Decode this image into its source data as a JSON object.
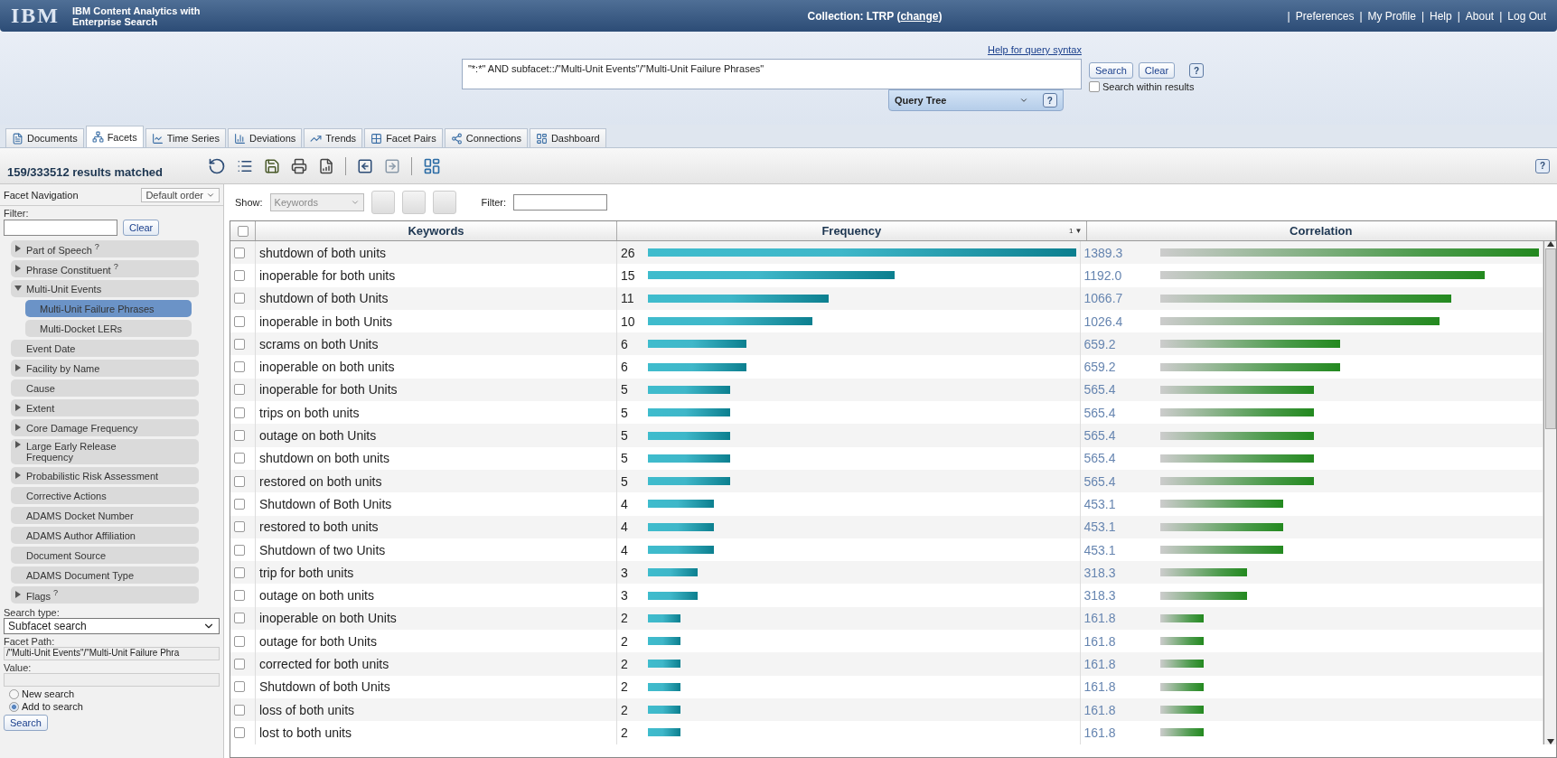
{
  "header": {
    "logo": "IBM",
    "product": [
      "IBM Content Analytics with",
      "Enterprise Search"
    ],
    "collection_label": "Collection: LTRP",
    "collection_open": "(",
    "change_link": "change",
    "collection_close": ")",
    "separator": "|",
    "links": [
      "Preferences",
      "My Profile",
      "Help",
      "About",
      "Log Out"
    ]
  },
  "query": {
    "help_link": "Help for query syntax",
    "value": "\"*:*\" AND subfacet::/\"Multi-Unit Events\"/\"Multi-Unit Failure Phrases\"",
    "search_button": "Search",
    "clear_button": "Clear",
    "help_button": "?",
    "within_results": {
      "label": "Search within results",
      "checked": false
    },
    "query_tree": {
      "title": "Query Tree",
      "help_button": "?"
    }
  },
  "tabs": [
    {
      "label": "Documents",
      "selected": false,
      "kind": "documents"
    },
    {
      "label": "Facets",
      "selected": true,
      "kind": "facets"
    },
    {
      "label": "Time Series",
      "selected": false,
      "kind": "timeseries"
    },
    {
      "label": "Deviations",
      "selected": false,
      "kind": "deviations"
    },
    {
      "label": "Trends",
      "selected": false,
      "kind": "trends"
    },
    {
      "label": "Facet Pairs",
      "selected": false,
      "kind": "pairs"
    },
    {
      "label": "Connections",
      "selected": false,
      "kind": "connections"
    },
    {
      "label": "Dashboard",
      "selected": false,
      "kind": "dashboard"
    }
  ],
  "toolbar": {
    "results": "159/333512 results matched",
    "help_button": "?"
  },
  "facet_nav": {
    "title": "Facet Navigation",
    "order": "Default order",
    "filter_label": "Filter:",
    "clear_button": "Clear",
    "items": [
      {
        "label": "Part of Speech $^{?}$",
        "expanded": false
      },
      {
        "label": "Phrase Constituent $^{?}$",
        "expanded": false
      },
      {
        "label": "Multi-Unit Events",
        "expanded": true,
        "children": [
          {
            "label": "Multi-Unit Failure Phrases",
            "selected": true
          },
          {
            "label": "Multi-Docket LERs",
            "selected": false
          }
        ]
      },
      {
        "label": "Event Date"
      },
      {
        "label": "Facility by Name",
        "expanded": false
      },
      {
        "label": "Cause"
      },
      {
        "label": "Extent",
        "expanded": false
      },
      {
        "label": "Core Damage Frequency",
        "expanded": false
      },
      {
        "label": "Large Early Release Frequency",
        "expanded": false
      },
      {
        "label": "Probabilistic Risk Assessment",
        "expanded": false
      },
      {
        "label": "Corrective Actions"
      },
      {
        "label": "ADAMS Docket Number"
      },
      {
        "label": "ADAMS Author Affiliation"
      },
      {
        "label": "Document Source"
      },
      {
        "label": "ADAMS Document Type"
      },
      {
        "label": "Flags $^{?}$",
        "expanded": false
      }
    ],
    "search_type_label": "Search type:",
    "search_type": "Subfacet search",
    "facet_path_label": "Facet Path:",
    "facet_path": "/\"Multi-Unit Events\"/\"Multi-Unit Failure Phra",
    "value_label": "Value:",
    "options": [
      {
        "label": "New search",
        "selected": false
      },
      {
        "label": "Add to search",
        "selected": true
      }
    ],
    "search_button": "Search"
  },
  "results": {
    "show_label": "Show:",
    "show_value": "Keywords",
    "filter_label": "Filter:",
    "columns": [
      "Keywords",
      "Frequency",
      "Correlation"
    ],
    "sort_marker": "1",
    "sort_arrow": "▼",
    "all_checked": false,
    "rows": [
      {
        "keyword": "shutdown of both units",
        "checked": false,
        "frequency": "26",
        "correlation": "1389.3"
      },
      {
        "keyword": "inoperable for both units",
        "checked": false,
        "frequency": "15",
        "correlation": "1192.0"
      },
      {
        "keyword": "shutdown of both Units",
        "checked": false,
        "frequency": "11",
        "correlation": "1066.7"
      },
      {
        "keyword": "inoperable in both Units",
        "checked": false,
        "frequency": "10",
        "correlation": "1026.4"
      },
      {
        "keyword": "scrams on both Units",
        "checked": false,
        "frequency": "6",
        "correlation": "659.2"
      },
      {
        "keyword": "inoperable on both units",
        "checked": false,
        "frequency": "6",
        "correlation": "659.2"
      },
      {
        "keyword": "inoperable for both Units",
        "checked": false,
        "frequency": "5",
        "correlation": "565.4"
      },
      {
        "keyword": "trips on both units",
        "checked": false,
        "frequency": "5",
        "correlation": "565.4"
      },
      {
        "keyword": "outage on both Units",
        "checked": false,
        "frequency": "5",
        "correlation": "565.4"
      },
      {
        "keyword": "shutdown on both units",
        "checked": false,
        "frequency": "5",
        "correlation": "565.4"
      },
      {
        "keyword": "restored on both units",
        "checked": false,
        "frequency": "5",
        "correlation": "565.4"
      },
      {
        "keyword": "Shutdown of Both Units",
        "checked": false,
        "frequency": "4",
        "correlation": "453.1"
      },
      {
        "keyword": "restored to both units",
        "checked": false,
        "frequency": "4",
        "correlation": "453.1"
      },
      {
        "keyword": "Shutdown of two Units",
        "checked": false,
        "frequency": "4",
        "correlation": "453.1"
      },
      {
        "keyword": "trip for both units",
        "checked": false,
        "frequency": "3",
        "correlation": "318.3"
      },
      {
        "keyword": "outage on both units",
        "checked": false,
        "frequency": "3",
        "correlation": "318.3"
      },
      {
        "keyword": "inoperable on both Units",
        "checked": false,
        "frequency": "2",
        "correlation": "161.8"
      },
      {
        "keyword": "outage for both Units",
        "checked": false,
        "frequency": "2",
        "correlation": "161.8"
      },
      {
        "keyword": "corrected for both units",
        "checked": false,
        "frequency": "2",
        "correlation": "161.8"
      },
      {
        "keyword": "Shutdown of both Units",
        "checked": false,
        "frequency": "2",
        "correlation": "161.8"
      },
      {
        "keyword": "loss of both units",
        "checked": false,
        "frequency": "2",
        "correlation": "161.8"
      },
      {
        "keyword": "lost to both units",
        "checked": false,
        "frequency": "2",
        "correlation": "161.8"
      }
    ]
  }
}
